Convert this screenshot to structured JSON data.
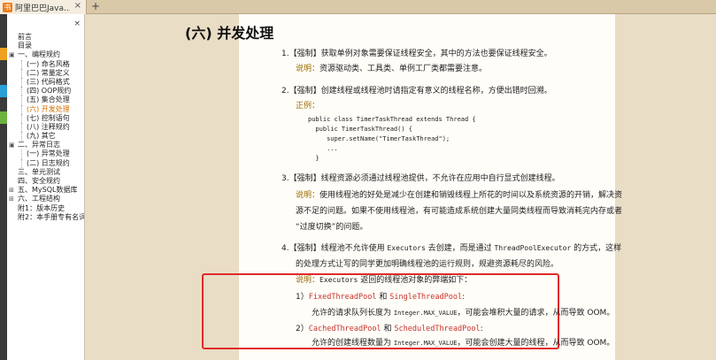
{
  "tab": {
    "icon": "书",
    "title": "阿里巴巴Java...",
    "close": "×",
    "add": "+"
  },
  "sidebar": {
    "close": "×",
    "items": [
      {
        "label": "前言",
        "level": 0,
        "twist": ""
      },
      {
        "label": "目录",
        "level": 0,
        "twist": ""
      },
      {
        "label": "一、编程规约",
        "level": 0,
        "twist": "▣"
      },
      {
        "label": "(一) 命名风格",
        "level": 1
      },
      {
        "label": "(二) 常量定义",
        "level": 1
      },
      {
        "label": "(三) 代码格式",
        "level": 1
      },
      {
        "label": "(四) OOP规约",
        "level": 1
      },
      {
        "label": "(五) 集合处理",
        "level": 1
      },
      {
        "label": "(六) 开发处理",
        "level": 1,
        "active": true
      },
      {
        "label": "(七) 控制语句",
        "level": 1
      },
      {
        "label": "(八) 注释规约",
        "level": 1
      },
      {
        "label": "(九) 其它",
        "level": 1
      },
      {
        "label": "二、异常日志",
        "level": 0,
        "twist": "▣"
      },
      {
        "label": "(一) 异常处理",
        "level": 1
      },
      {
        "label": "(二) 日志规约",
        "level": 1
      },
      {
        "label": "三、单元测试",
        "level": 0,
        "twist": ""
      },
      {
        "label": "四、安全规约",
        "level": 0,
        "twist": ""
      },
      {
        "label": "五、MySQL数据库",
        "level": 0,
        "twist": "⊞"
      },
      {
        "label": "六、工程结构",
        "level": 0,
        "twist": "⊞"
      },
      {
        "label": "附1：版本历史",
        "level": 0,
        "twist": ""
      },
      {
        "label": "附2：本手册专有名词",
        "level": 0,
        "twist": ""
      }
    ]
  },
  "doc": {
    "heading": "(六) 并发处理",
    "s1": "1.【强制】获取单例对象需要保证线程安全，其中的方法也要保证线程安全。",
    "s1_note_label": "说明：",
    "s1_note": "资源驱动类、工具类、单例工厂类都需要注意。",
    "s2": "2.【强制】创建线程或线程池时请指定有意义的线程名称，方便出错时回溯。",
    "s2_example": "正例：",
    "code": [
      "public class TimerTaskThread extends Thread {",
      "  public TimerTaskThread() {",
      "     super.setName(\"TimerTaskThread\");",
      "     ...",
      "  }"
    ],
    "s3": "3.【强制】线程资源必须通过线程池提供，不允许在应用中自行显式创建线程。",
    "s3_note_label": "说明：",
    "s3_note_1": "使用线程池的好处是减少在创建和销毁线程上所花的时间以及系统资源的开销，解决资",
    "s3_note_2": "源不足的问题。如果不使用线程池，有可能造成系统创建大量同类线程而导致消耗完内存或者",
    "s3_note_3": "“过度切换”的问题。",
    "s4_a": "4.【强制】线程池不允许使用 ",
    "s4_exec": "Executors",
    "s4_b": " 去创建，而是通过 ",
    "s4_tpe": "ThreadPoolExecutor",
    "s4_c": " 的方式，这样",
    "s4_2": "的处理方式让写的同学更加明确线程池的运行规则，规避资源耗尽的风险。",
    "s4_note_label": "说明：",
    "s4_note_exec": "Executors",
    "s4_note_rest": " 返回的线程池对象的弊端如下：",
    "b1_num": "1）",
    "b1_a": "FixedThreadPool",
    "b1_and": " 和 ",
    "b1_b": "SingleThreadPool",
    "b1_colon": ":",
    "b1_desc_a": "允许的请求队列长度为 ",
    "b1_desc_code": "Integer.MAX_VALUE",
    "b1_desc_b": "，可能会堆积大量的请求，从而导致 OOM。",
    "b2_num": "2）",
    "b2_a": "CachedThreadPool",
    "b2_and": " 和 ",
    "b2_b": "ScheduledThreadPool",
    "b2_colon": ":",
    "b2_desc_a": "允许的创建线程数量为 ",
    "b2_desc_code": "Integer.MAX_VALUE",
    "b2_desc_b": "，可能会创建大量的线程，从而导致 OOM。"
  },
  "colors": {
    "accent": "#f07c1c",
    "note": "#9a6b00",
    "highlight": "#e02b2b",
    "code_red": "#c8322a"
  }
}
